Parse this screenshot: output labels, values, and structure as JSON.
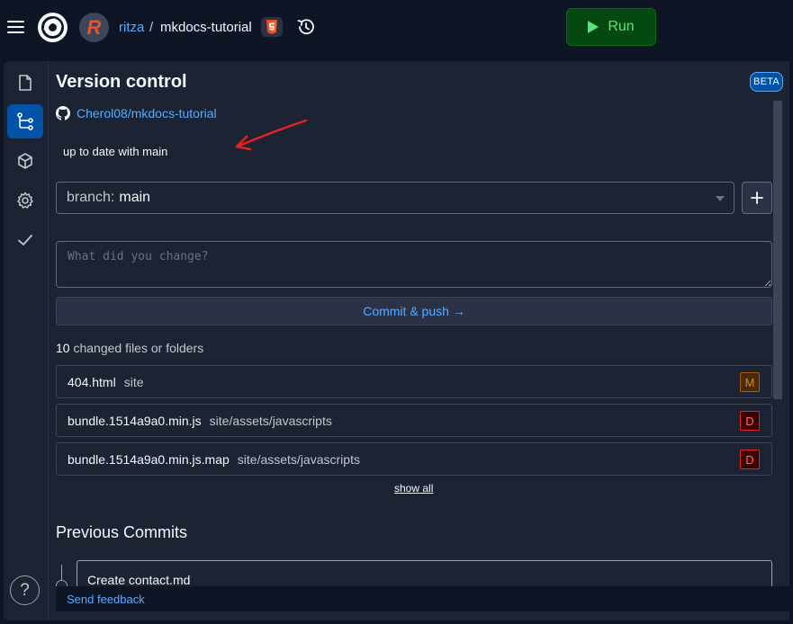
{
  "topbar": {
    "username": "ritza",
    "separator": "/",
    "repl_name": "mkdocs-tutorial",
    "run_label": "Run",
    "accent_run": "#044a10"
  },
  "panel": {
    "title": "Version control",
    "beta_label": "BETA",
    "repo_link": "Cherol08/mkdocs-tutorial",
    "status": "up to date with main",
    "branch_label": "branch:",
    "branch_value": "main",
    "commit_placeholder": "What did you change?",
    "commit_button": "Commit & push →",
    "changes_count": "10",
    "changes_suffix": " changed files or folders",
    "files": [
      {
        "name": "404.html",
        "path": "site",
        "status": "M"
      },
      {
        "name": "bundle.1514a9a0.min.js",
        "path": "site/assets/javascripts",
        "status": "D"
      },
      {
        "name": "bundle.1514a9a0.min.js.map",
        "path": "site/assets/javascripts",
        "status": "D"
      }
    ],
    "show_all": "show all",
    "previous_commits_title": "Previous Commits",
    "commits": [
      {
        "message": "Create contact.md"
      }
    ],
    "feedback": "Send feedback"
  },
  "rail": {
    "items": [
      "files-icon",
      "version-control-icon",
      "packages-icon",
      "settings-icon",
      "check-icon"
    ],
    "help": "?"
  },
  "colors": {
    "link": "#57abff",
    "modified": "#d68a1c",
    "deleted": "#ff6b6b",
    "annotation": "#e52222"
  }
}
